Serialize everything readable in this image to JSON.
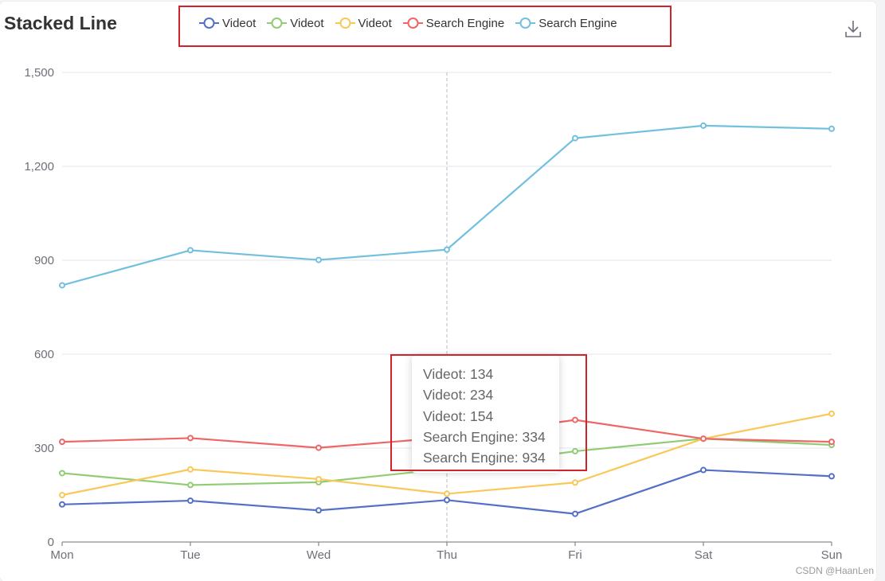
{
  "chart_data": {
    "type": "line",
    "title": "Stacked Line",
    "categories": [
      "Mon",
      "Tue",
      "Wed",
      "Thu",
      "Fri",
      "Sat",
      "Sun"
    ],
    "ylim": [
      0,
      1500
    ],
    "yticks": [
      "0",
      "300",
      "600",
      "900",
      "1,200",
      "1,500"
    ],
    "ytick_values": [
      0,
      300,
      600,
      900,
      1200,
      1500
    ],
    "grid": true,
    "legend_position": "top-center",
    "series": [
      {
        "name": "Videot",
        "color": "#5470c6",
        "values": [
          120,
          132,
          101,
          134,
          90,
          230,
          210
        ]
      },
      {
        "name": "Videot",
        "color": "#91cc75",
        "values": [
          220,
          182,
          191,
          234,
          290,
          330,
          310
        ]
      },
      {
        "name": "Videot",
        "color": "#fac858",
        "values": [
          150,
          232,
          201,
          154,
          190,
          330,
          410
        ]
      },
      {
        "name": "Search Engine",
        "color": "#ee6666",
        "values": [
          320,
          332,
          301,
          334,
          390,
          330,
          320
        ]
      },
      {
        "name": "Search Engine",
        "color": "#73c0de",
        "values": [
          820,
          932,
          901,
          934,
          1290,
          1330,
          1320
        ]
      }
    ]
  },
  "tooltip": {
    "category": "Thu",
    "lines": [
      "Videot: 134",
      "Videot: 234",
      "Videot: 154",
      "Search Engine: 334",
      "Search Engine: 934"
    ]
  },
  "toolbar": {
    "download_icon": "download-icon"
  },
  "watermark": "CSDN @HaanLen"
}
